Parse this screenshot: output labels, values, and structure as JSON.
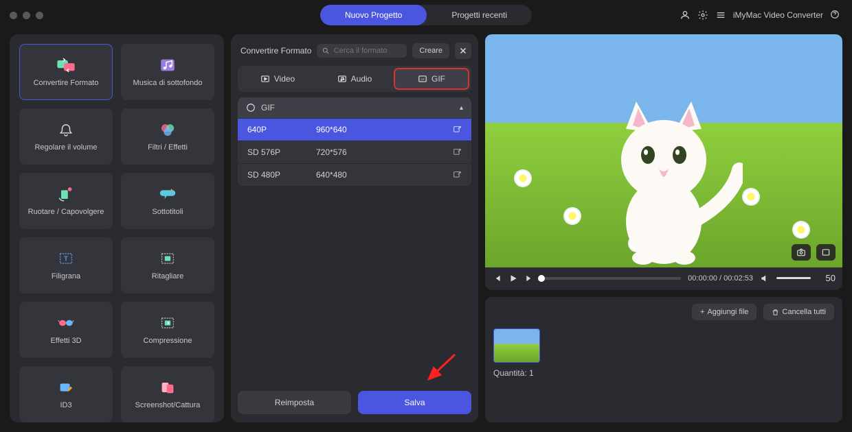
{
  "header": {
    "tab_new": "Nuovo Progetto",
    "tab_recent": "Progetti recenti",
    "app_name": "iMyMac Video Converter"
  },
  "sidebar": {
    "items": [
      "Convertire Formato",
      "Musica di sottofondo",
      "Regolare il volume",
      "Filtri / Effetti",
      "Ruotare / Capovolgere",
      "Sottotitoli",
      "Filigrana",
      "Ritagliare",
      "Effetti 3D",
      "Compressione",
      "ID3",
      "Screenshot/Cattura"
    ]
  },
  "center": {
    "title": "Convertire Formato",
    "search_placeholder": "Cerca il formato",
    "create": "Creare",
    "tabs": {
      "video": "Video",
      "audio": "Audio",
      "gif": "GIF"
    },
    "group_name": "GIF",
    "rows": [
      {
        "q": "640P",
        "r": "960*640"
      },
      {
        "q": "SD 576P",
        "r": "720*576"
      },
      {
        "q": "SD 480P",
        "r": "640*480"
      }
    ],
    "reset": "Reimposta",
    "save": "Salva"
  },
  "player": {
    "time_cur": "00:00:00",
    "time_tot": "00:02:53",
    "volume": "50"
  },
  "files": {
    "add": "Aggiungi file",
    "clear": "Cancella tutti",
    "qty_label": "Quantità:",
    "qty_val": "1"
  }
}
